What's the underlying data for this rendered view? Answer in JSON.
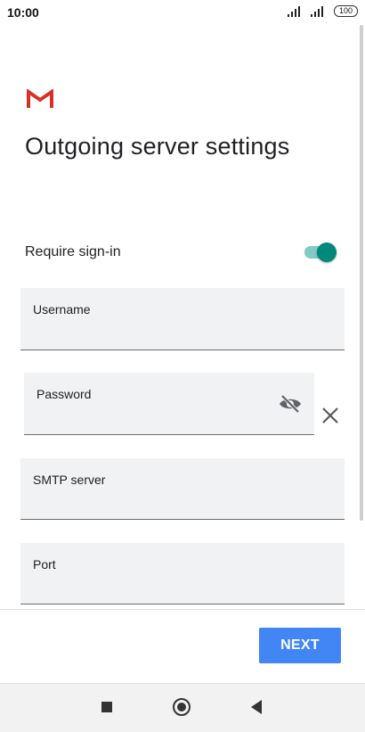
{
  "status_bar": {
    "time": "10:00",
    "battery": "100"
  },
  "app": {
    "logo": "gmail-logo-icon",
    "title": "Outgoing server settings"
  },
  "require_signin": {
    "label": "Require sign-in",
    "enabled": true
  },
  "fields": {
    "username": {
      "label": "Username",
      "value": ""
    },
    "password": {
      "label": "Password",
      "value": ""
    },
    "smtp_server": {
      "label": "SMTP server",
      "value": ""
    },
    "port": {
      "label": "Port",
      "value": ""
    }
  },
  "actions": {
    "next_label": "NEXT"
  },
  "colors": {
    "accent": "#00897b",
    "button": "#4285f4"
  },
  "nav": {
    "icons": [
      "recents-icon",
      "home-icon",
      "back-icon"
    ]
  }
}
